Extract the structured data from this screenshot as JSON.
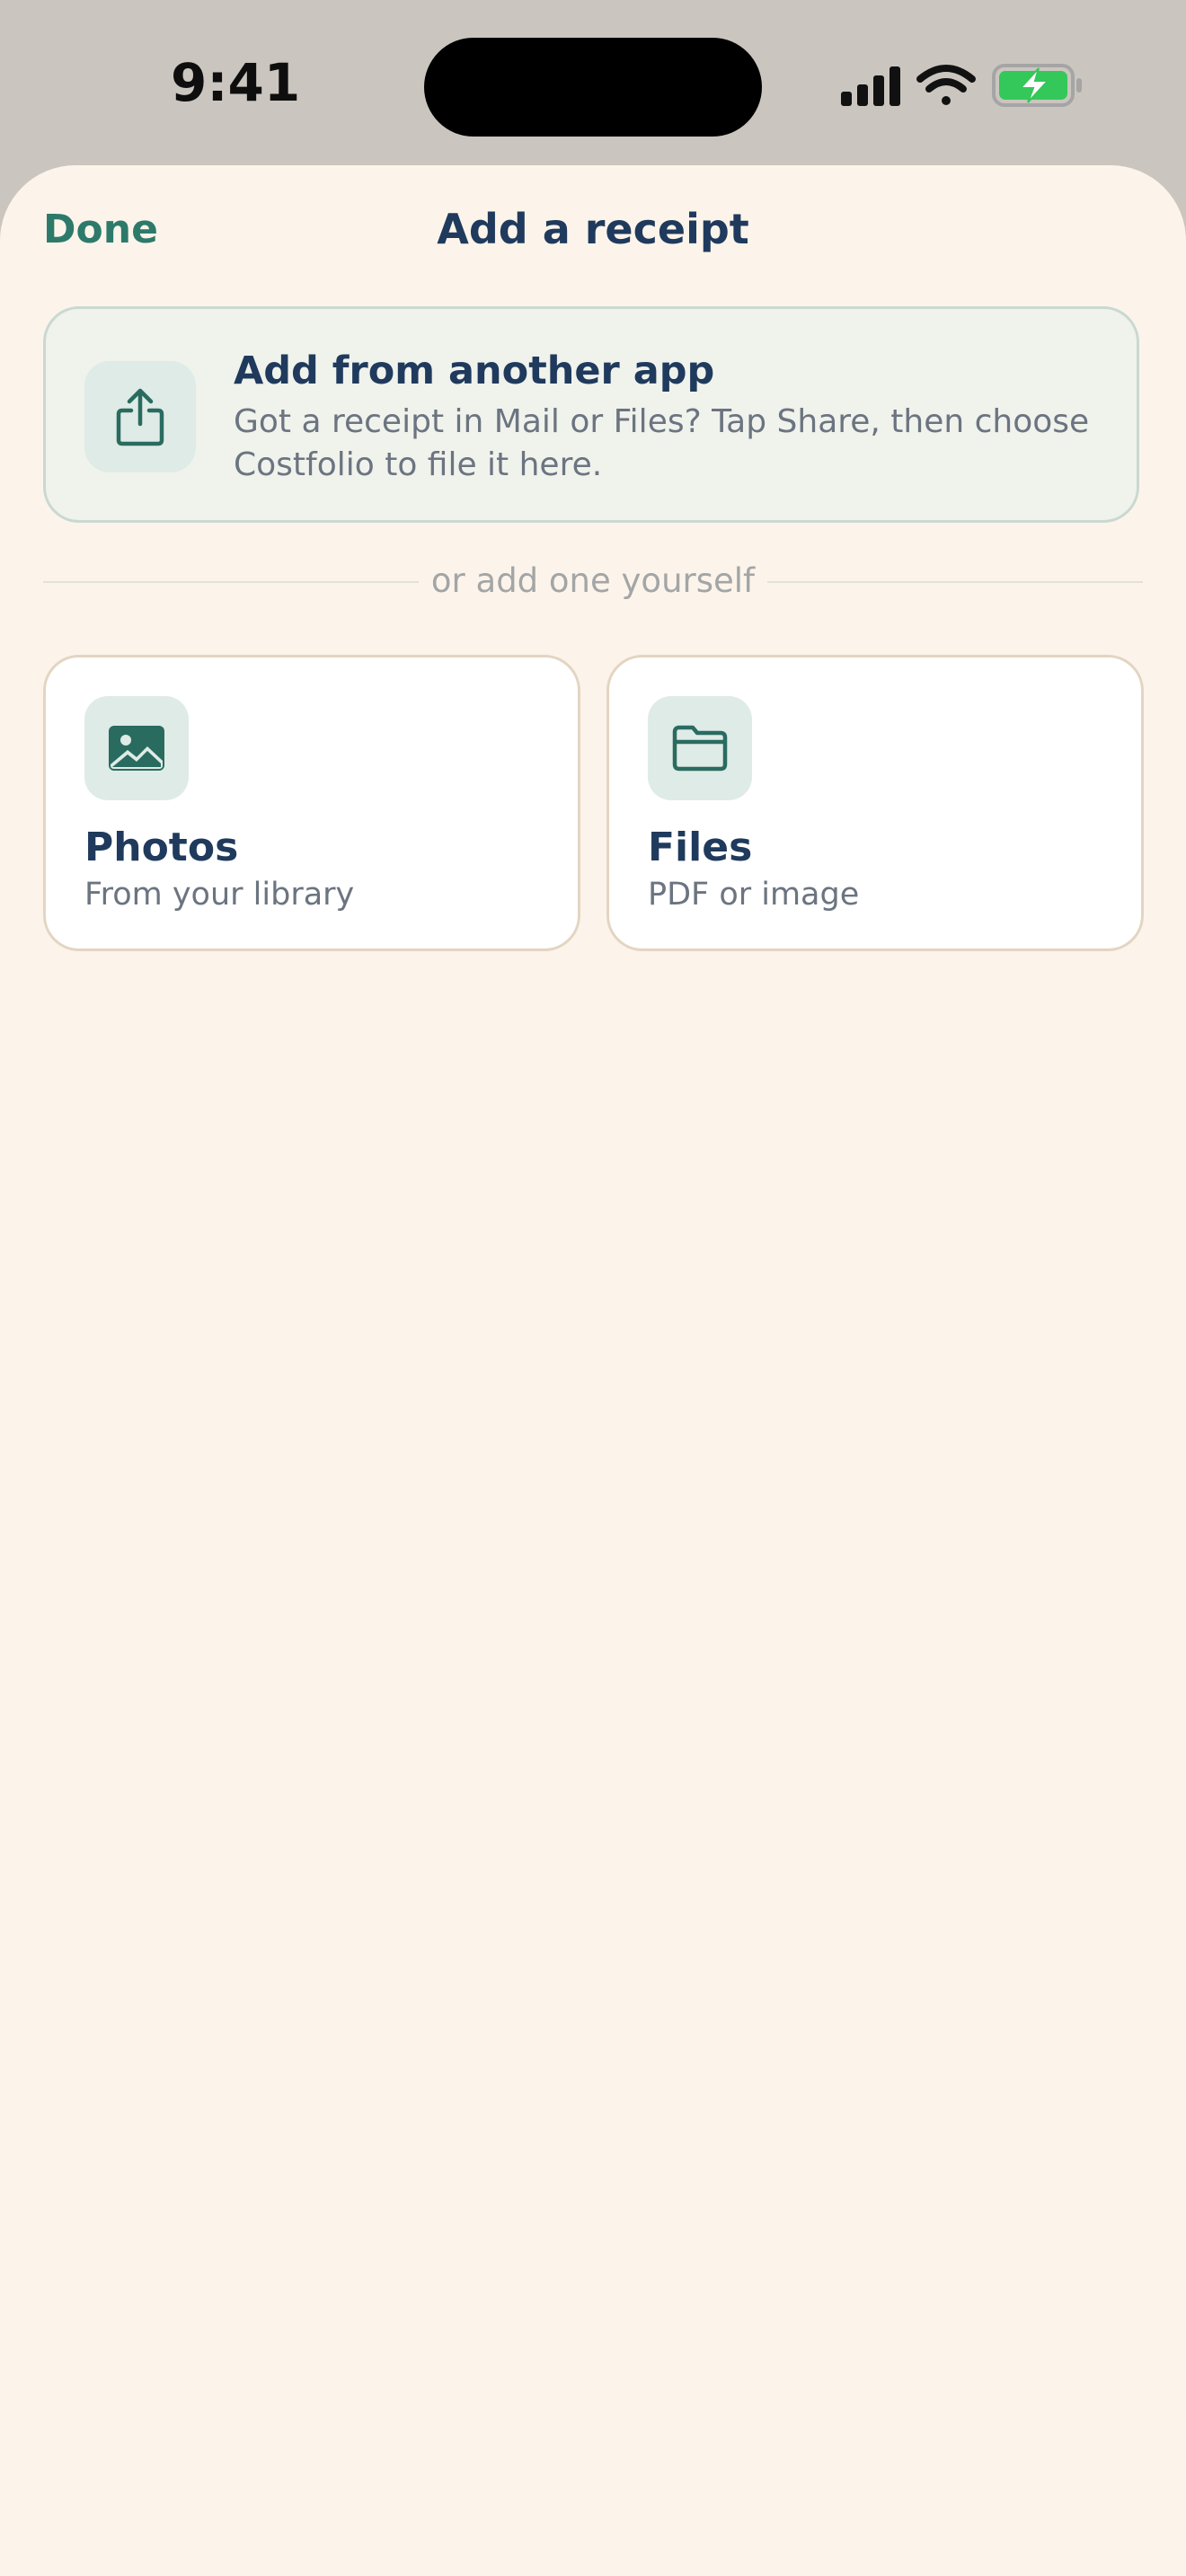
{
  "status_bar": {
    "time": "9:41",
    "signal_icon": "cellular-signal-icon",
    "wifi_icon": "wifi-icon",
    "battery_icon": "battery-charging-icon",
    "battery_color": "#34c759"
  },
  "nav": {
    "done_label": "Done",
    "title": "Add a receipt"
  },
  "share_card": {
    "icon": "share-icon",
    "title": "Add from another app",
    "description": "Got a receipt in Mail or Files? Tap Share, then choose Costfolio to file it here."
  },
  "divider": {
    "label": "or add one yourself"
  },
  "options": [
    {
      "icon": "photo-icon",
      "title": "Photos",
      "subtitle": "From your library"
    },
    {
      "icon": "folder-icon",
      "title": "Files",
      "subtitle": "PDF or image"
    }
  ],
  "colors": {
    "accent": "#2d7a6a",
    "title": "#1f3a5c",
    "sheet_background": "#fcf4ea",
    "icon_tile": "#dfebe6"
  }
}
